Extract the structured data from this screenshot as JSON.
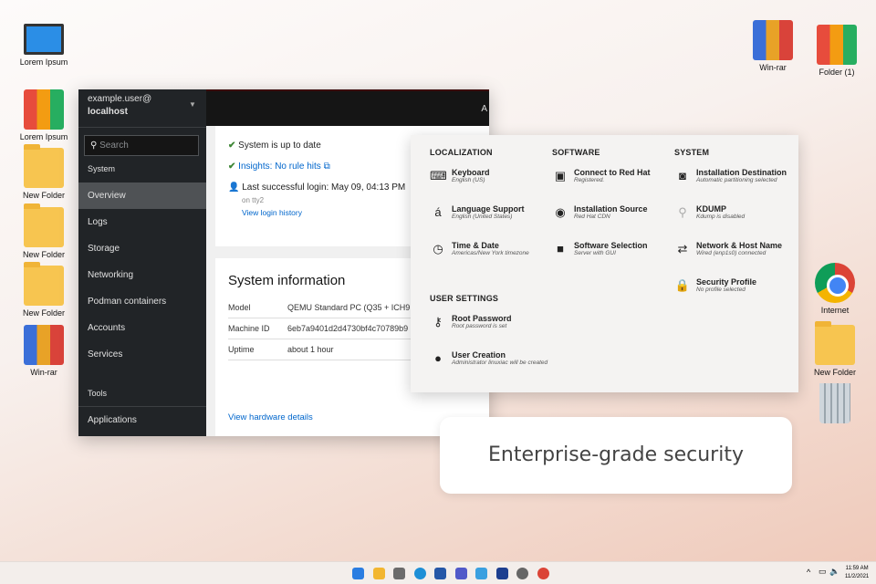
{
  "desktop": {
    "left": [
      "Lorem Ipsum",
      "Lorem Ipsum",
      "New Folder",
      "New Folder",
      "New Folder",
      "Win-rar"
    ],
    "right": [
      "Win-rar",
      "Folder (1)",
      "Internet",
      "New Folder"
    ]
  },
  "cockpit": {
    "user": "example.user@",
    "host": "localhost",
    "search_placeholder": "Search",
    "section_system": "System",
    "nav": [
      "Overview",
      "Logs",
      "Storage",
      "Networking",
      "Podman containers",
      "Accounts",
      "Services"
    ],
    "section_tools": "Tools",
    "nav_tools": [
      "Applications"
    ],
    "top_right": "A",
    "health": {
      "updates": "System is up to date",
      "insights": "Insights: No rule hits",
      "login": "Last successful login: May 09, 04:13 PM",
      "tty": "on tty2",
      "history": "View login history"
    },
    "sysinfo": {
      "title": "System information",
      "rows": [
        {
          "k": "Model",
          "v": "QEMU Standard PC (Q35 + ICH9, 2"
        },
        {
          "k": "Machine ID",
          "v": "6eb7a9401d2d4730bf4c70789b9"
        },
        {
          "k": "Uptime",
          "v": "about 1 hour"
        }
      ],
      "hw": "View hardware details"
    }
  },
  "installer": {
    "columns": [
      {
        "title": "LOCALIZATION",
        "items": [
          {
            "icon": "keyboard-icon",
            "g": "⌨",
            "name": "Keyboard",
            "sub": "English (US)"
          },
          {
            "icon": "language-icon",
            "g": "á",
            "name": "Language Support",
            "sub": "English (United States)"
          },
          {
            "icon": "clock-icon",
            "g": "◷",
            "name": "Time & Date",
            "sub": "Americas/New York timezone"
          }
        ]
      },
      {
        "title": "SOFTWARE",
        "items": [
          {
            "icon": "certificate-icon",
            "g": "▣",
            "name": "Connect to Red Hat",
            "sub": "Registered."
          },
          {
            "icon": "disc-icon",
            "g": "◉",
            "name": "Installation Source",
            "sub": "Red Hat CDN"
          },
          {
            "icon": "package-icon",
            "g": "■",
            "name": "Software Selection",
            "sub": "Server with GUI"
          }
        ]
      },
      {
        "title": "SYSTEM",
        "items": [
          {
            "icon": "disk-icon",
            "g": "◙",
            "name": "Installation Destination",
            "sub": "Automatic partitioning selected"
          },
          {
            "icon": "search-icon",
            "g": "⚲",
            "name": "KDUMP",
            "sub": "Kdump is disabled"
          },
          {
            "icon": "network-icon",
            "g": "⇄",
            "name": "Network & Host Name",
            "sub": "Wired (enp1s0) connected"
          },
          {
            "icon": "lock-icon",
            "g": "🔒",
            "name": "Security Profile",
            "sub": "No profile selected"
          }
        ]
      }
    ],
    "user_settings": {
      "title": "USER SETTINGS",
      "items": [
        {
          "icon": "key-icon",
          "g": "⚷",
          "name": "Root Password",
          "sub": "Root password is set"
        },
        {
          "icon": "user-icon",
          "g": "●",
          "name": "User Creation",
          "sub": "Administrator linuxiac will be created"
        }
      ]
    }
  },
  "callout": "Enterprise-grade security",
  "taskbar": {
    "time": "11:59 AM",
    "date": "11/2/2021",
    "apps": [
      "start",
      "file-explorer",
      "camera",
      "edge",
      "store",
      "teams",
      "photos",
      "app",
      "settings",
      "chrome"
    ],
    "colors": [
      "#2a7de1",
      "#f2b630",
      "#6b6b6b",
      "#1d8fd6",
      "#2557a7",
      "#5059c9",
      "#3aa0e0",
      "#1d3f8f",
      "#666666",
      "#db4437"
    ]
  }
}
